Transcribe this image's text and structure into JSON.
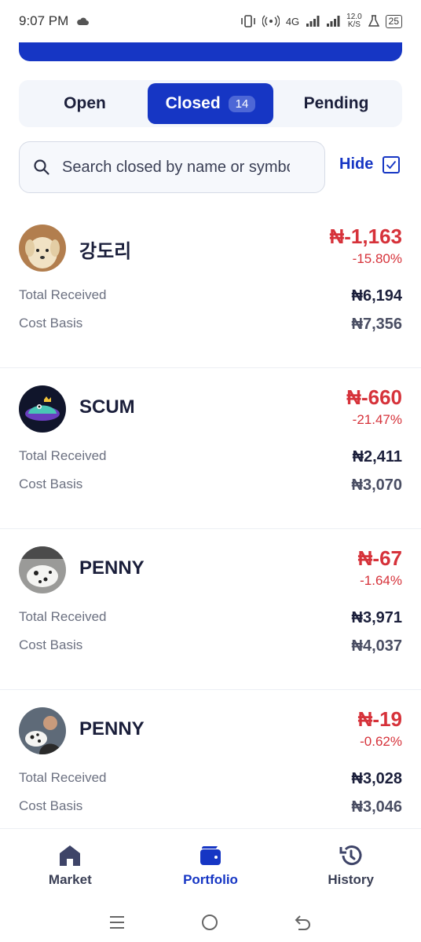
{
  "status_bar": {
    "time": "9:07 PM",
    "network_speed": "12.0",
    "network_unit": "K/S",
    "network_type": "4G",
    "battery": "25"
  },
  "tabs": [
    {
      "label": "Open",
      "active": false
    },
    {
      "label": "Closed",
      "active": true,
      "count": "14"
    },
    {
      "label": "Pending",
      "active": false
    }
  ],
  "search": {
    "placeholder": "Search closed by name or symbol"
  },
  "hide_toggle": {
    "label": "Hide",
    "checked": true
  },
  "positions": [
    {
      "name": "강도리",
      "pnl": "₦-1,163",
      "pnl_pct": "-15.80%",
      "total_received_label": "Total Received",
      "total_received": "₦6,194",
      "cost_basis_label": "Cost Basis",
      "cost_basis": "₦7,356",
      "avatar": "puppy-avatar"
    },
    {
      "name": "SCUM",
      "pnl": "₦-660",
      "pnl_pct": "-21.47%",
      "total_received_label": "Total Received",
      "total_received": "₦2,411",
      "cost_basis_label": "Cost Basis",
      "cost_basis": "₦3,070",
      "avatar": "monster-avatar"
    },
    {
      "name": "PENNY",
      "pnl": "₦-67",
      "pnl_pct": "-1.64%",
      "total_received_label": "Total Received",
      "total_received": "₦3,971",
      "cost_basis_label": "Cost Basis",
      "cost_basis": "₦4,037",
      "avatar": "dalmatian-avatar"
    },
    {
      "name": "PENNY",
      "pnl": "₦-19",
      "pnl_pct": "-0.62%",
      "total_received_label": "Total Received",
      "total_received": "₦3,028",
      "cost_basis_label": "Cost Basis",
      "cost_basis": "₦3,046",
      "avatar": "dalmatian-person-avatar"
    }
  ],
  "bottom_nav": [
    {
      "label": "Market",
      "icon": "home-icon",
      "active": false
    },
    {
      "label": "Portfolio",
      "icon": "wallet-icon",
      "active": true
    },
    {
      "label": "History",
      "icon": "history-icon",
      "active": false
    }
  ],
  "colors": {
    "accent": "#1636c4",
    "negative": "#d6323a"
  }
}
